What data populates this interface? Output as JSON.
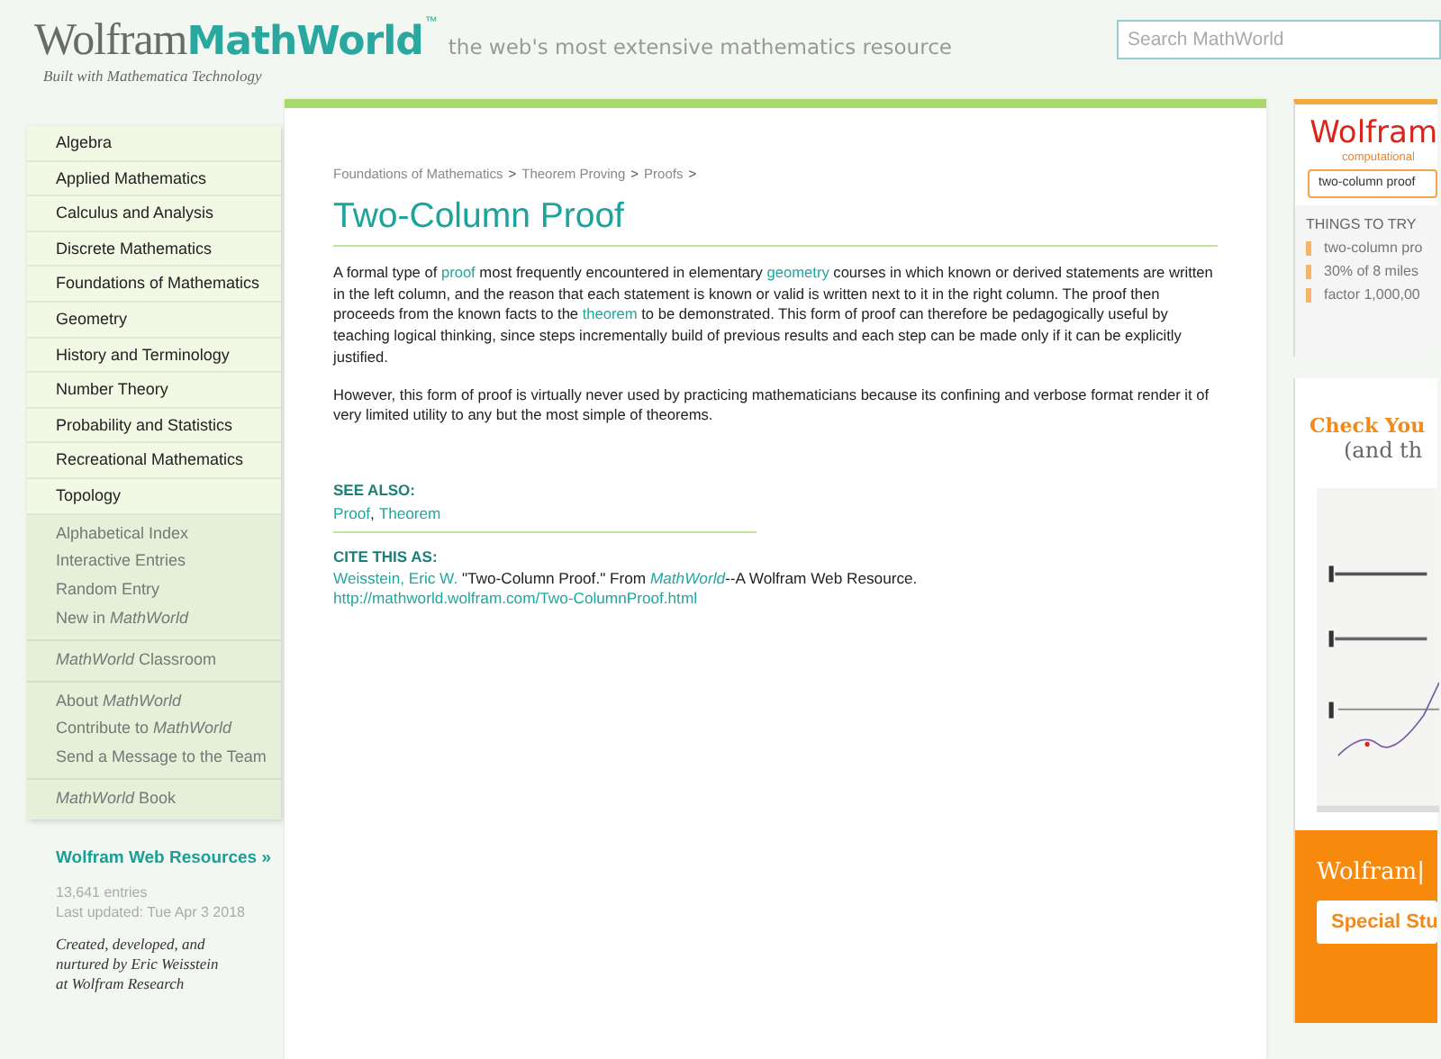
{
  "header": {
    "logo_left": "Wolfram",
    "logo_right": "MathWorld",
    "trademark": "™",
    "built_with": "Built with Mathematica Technology",
    "tagline": "the web's most extensive mathematics resource",
    "search": {
      "placeholder": "Search MathWorld"
    }
  },
  "sidebar": {
    "groups": [
      {
        "kind": "subjects",
        "items": [
          "Algebra",
          "Applied Mathematics",
          "Calculus and Analysis",
          "Discrete Mathematics",
          "Foundations of Mathematics",
          "Geometry",
          "History and Terminology",
          "Number Theory",
          "Probability and Statistics",
          "Recreational Mathematics",
          "Topology"
        ]
      },
      {
        "kind": "links",
        "items": [
          "Alphabetical Index",
          "Interactive Entries",
          "Random Entry",
          "New in *MathWorld*"
        ]
      },
      {
        "kind": "links",
        "items": [
          "*MathWorld* Classroom"
        ]
      },
      {
        "kind": "links",
        "items": [
          "About *MathWorld*",
          "Contribute to *MathWorld*",
          "Send a Message to the Team"
        ]
      },
      {
        "kind": "links",
        "items": [
          "*MathWorld* Book"
        ]
      }
    ],
    "resources_link": "Wolfram Web Resources »",
    "entries": "13,641 entries",
    "updated": "Last updated: Tue Apr 3 2018",
    "credit": [
      "Created, developed, and",
      "nurtured by Eric Weisstein",
      "at Wolfram Research"
    ]
  },
  "article": {
    "breadcrumb": [
      {
        "kind": "link",
        "text": "Foundations of Mathematics"
      },
      {
        "kind": "sep",
        "text": ">"
      },
      {
        "kind": "link",
        "text": "Theorem Proving"
      },
      {
        "kind": "sep",
        "text": ">"
      },
      {
        "kind": "link",
        "text": "Proofs"
      },
      {
        "kind": "sep",
        "text": ">"
      }
    ],
    "title": "Two-Column Proof",
    "paragraphs": [
      [
        {
          "kind": "text",
          "text": "A formal type of "
        },
        {
          "kind": "link",
          "text": "proof"
        },
        {
          "kind": "text",
          "text": " most frequently encountered in elementary "
        },
        {
          "kind": "link",
          "text": "geometry"
        },
        {
          "kind": "text",
          "text": " courses in which known or derived statements are written in the left column, and the reason that each statement is known or valid is written next to it in the right column. The proof then proceeds from the known facts to the "
        },
        {
          "kind": "link",
          "text": "theorem"
        },
        {
          "kind": "text",
          "text": " to be demonstrated. This form of proof can therefore be pedagogically useful by teaching logical thinking, since steps incrementally build of previous results and each step can be made only if it can be explicitly justified."
        }
      ],
      [
        {
          "kind": "text",
          "text": "However, this form of proof is virtually never used by practicing mathematicians because its confining and verbose format render it of very limited utility to any but the most simple of theorems."
        }
      ]
    ],
    "see_also": {
      "heading": "SEE ALSO:",
      "links": [
        "Proof",
        "Theorem"
      ],
      "separator": ", "
    },
    "cite": {
      "heading": "CITE THIS AS:",
      "parts": [
        {
          "kind": "link",
          "text": "Weisstein, Eric W."
        },
        {
          "kind": "text",
          "text": " \"Two-Column Proof.\" From "
        },
        {
          "kind": "italic_link",
          "text": "MathWorld"
        },
        {
          "kind": "text",
          "text": "--A Wolfram Web Resource. "
        },
        {
          "kind": "link",
          "text": "http://mathworld.wolfram.com/Two-ColumnProof.html"
        }
      ]
    }
  },
  "alpha_widget": {
    "logo": "Wolfram",
    "subtitle": "computational",
    "input": "two-column proof",
    "things_heading": "THINGS TO TRY",
    "things": [
      "two-column pro",
      "30% of 8 miles",
      "factor 1,000,00"
    ]
  },
  "ad": {
    "headline": "Check You",
    "subhead": "(and th",
    "brand": "Wolfram|",
    "button": "Special Stu"
  }
}
